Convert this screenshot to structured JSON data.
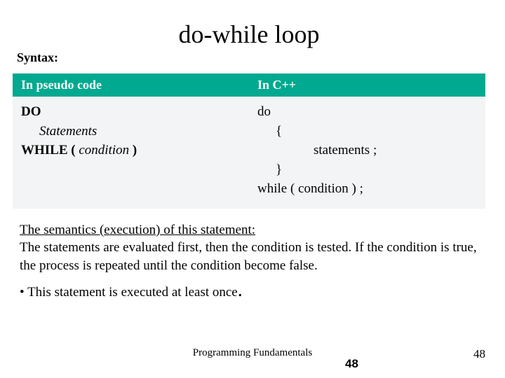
{
  "title": "do-while loop",
  "syntax_label": "Syntax:",
  "table": {
    "header_left": "In pseudo code",
    "header_right": "In C++",
    "pseudo": {
      "do": "DO",
      "statements": "Statements",
      "while_prefix": "WHILE ( ",
      "while_cond": "condition",
      "while_suffix": " )"
    },
    "cpp": {
      "do": "do",
      "open": "{",
      "stmts": "statements ;",
      "close": "}",
      "while": "while ( condition ) ;"
    }
  },
  "semantics": {
    "heading": "The semantics (execution) of this statement:",
    "body": "The statements are evaluated first, then the condition is tested. If the condition is true, the process is repeated  until the condition become false."
  },
  "note": {
    "bullet": "• ",
    "text": "This statement is executed at least once",
    "period": "."
  },
  "footer": {
    "center": "Programming Fundamentals",
    "page_bold": "48",
    "page_right": "48"
  }
}
